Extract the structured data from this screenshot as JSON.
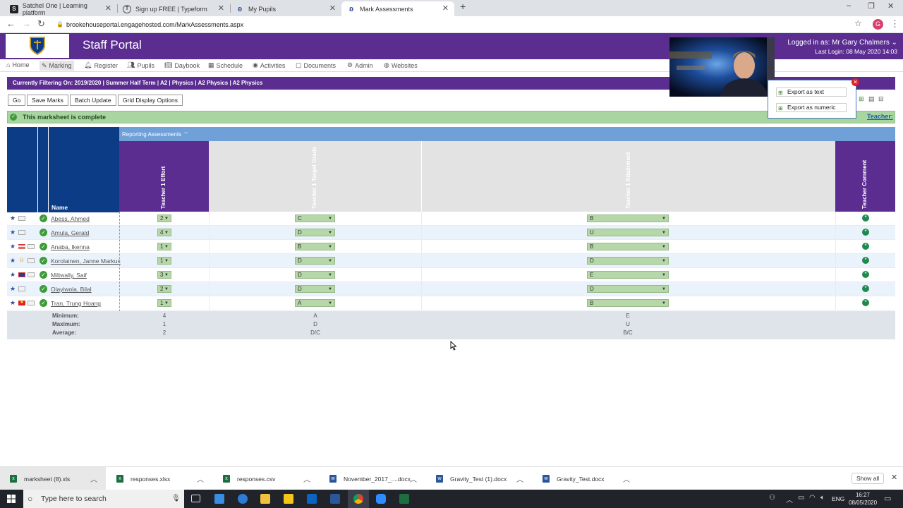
{
  "browser": {
    "tabs": [
      {
        "title": "Satchel One | Learning platform",
        "active": false
      },
      {
        "title": "Sign up FREE | Typeform",
        "active": false
      },
      {
        "title": "My Pupils",
        "active": false
      },
      {
        "title": "Mark Assessments",
        "active": true
      }
    ],
    "url": "brookehouseportal.engagehosted.com/MarkAssessments.aspx",
    "profile_initial": "G"
  },
  "portal": {
    "title": "Staff Portal",
    "logged_in": "Logged in as: Mr Gary Chalmers",
    "last_login": "Last Login: 08 May 2020 14:03"
  },
  "menu": [
    {
      "label": "Home",
      "icon": "home-icon"
    },
    {
      "label": "Marking",
      "icon": "pencil-icon"
    },
    {
      "label": "Register",
      "icon": "bell-icon"
    },
    {
      "label": "Pupils",
      "icon": "users-icon"
    },
    {
      "label": "Daybook",
      "icon": "book-icon"
    },
    {
      "label": "Schedule",
      "icon": "calendar-icon"
    },
    {
      "label": "Activities",
      "icon": "globe-icon"
    },
    {
      "label": "Documents",
      "icon": "document-icon"
    },
    {
      "label": "Admin",
      "icon": "gear-icon"
    },
    {
      "label": "Websites",
      "icon": "web-icon"
    }
  ],
  "filter": "Currently Filtering On: 2019/2020 | Summer Half Term | A2 | Physics | A2 Physics | A2 Physics",
  "buttons": {
    "go": "Go",
    "save": "Save Marks",
    "batch": "Batch Update",
    "grid": "Grid Display Options"
  },
  "status": {
    "message": "This marksheet is complete",
    "teacher_link": "Teacher:"
  },
  "export": {
    "text": "Export as text",
    "numeric": "Export as numeric"
  },
  "grid": {
    "group_header": "Reporting Assessments",
    "name_header": "Name",
    "columns": [
      "Teacher 1 Effort",
      "Teacher 1 Target Grade",
      "Teacher 1 Attainment",
      "Teacher Comment"
    ],
    "rows": [
      {
        "name": "Abess, Ahmed",
        "effort": "2",
        "target": "C",
        "attainment": "B",
        "flag": "none"
      },
      {
        "name": "Amula, Gerald",
        "effort": "4",
        "target": "D",
        "attainment": "U",
        "flag": "none"
      },
      {
        "name": "Anaba, Ikenna",
        "effort": "1",
        "target": "B",
        "attainment": "B",
        "flag": "us"
      },
      {
        "name": "Korolainen, Janne Markus",
        "effort": "1",
        "target": "D",
        "attainment": "D",
        "flag": "smile"
      },
      {
        "name": "Miltwally, Saif",
        "effort": "3",
        "target": "D",
        "attainment": "E",
        "flag": "uk"
      },
      {
        "name": "Olayiwola, Bilal",
        "effort": "2",
        "target": "D",
        "attainment": "D",
        "flag": "none"
      },
      {
        "name": "Tran, Trung Hoang",
        "effort": "1",
        "target": "A",
        "attainment": "B",
        "flag": "vn"
      }
    ],
    "stats": {
      "labels": [
        "Minimum:",
        "Maximum:",
        "Average:"
      ],
      "effort": [
        "4",
        "1",
        "2"
      ],
      "target": [
        "A",
        "D",
        "D/C"
      ],
      "attainment": [
        "E",
        "U",
        "B/C"
      ]
    }
  },
  "downloads": {
    "items": [
      {
        "name": "marksheet (8).xls",
        "type": "xls",
        "color": "#1d6f42"
      },
      {
        "name": "responses.xlsx",
        "type": "xlsx",
        "color": "#1d6f42"
      },
      {
        "name": "responses.csv",
        "type": "csv",
        "color": "#1d6f42"
      },
      {
        "name": "November_2017_....docx",
        "type": "docx",
        "color": "#2b579a"
      },
      {
        "name": "Gravity_Test (1).docx",
        "type": "docx",
        "color": "#2b579a"
      },
      {
        "name": "Gravity_Test.docx",
        "type": "docx",
        "color": "#2b579a"
      }
    ],
    "show_all": "Show all"
  },
  "taskbar": {
    "search_placeholder": "Type here to search",
    "lang": "ENG",
    "time": "16:27",
    "date": "08/05/2020"
  }
}
